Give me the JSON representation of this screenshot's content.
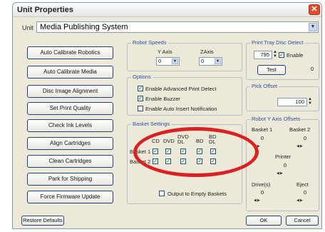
{
  "window": {
    "title": "Unit Properties",
    "close_icon": "close-icon"
  },
  "unit": {
    "label": "Unit",
    "value": "Media Publishing System"
  },
  "buttons": [
    "Auto Calibrate Robotics",
    "Auto Calibrate Media",
    "Disc Image Alignment",
    "Set Print Quality",
    "Check Ink Levels",
    "Align Cartridges",
    "Clean Cartridges",
    "Park for Shipping",
    "Force Firmware Update"
  ],
  "robot_speeds": {
    "legend": "Robot Speeds",
    "y_label": "Y Axis",
    "y_value": "0",
    "z_label": "ZAxis",
    "z_value": "0"
  },
  "options": {
    "legend": "Options",
    "items": [
      {
        "label": "Enable Advanced Print Detect",
        "checked": true
      },
      {
        "label": "Enable Buzzer",
        "checked": true
      },
      {
        "label": "Enable Auto Insert Notification",
        "checked": false
      }
    ]
  },
  "basket": {
    "legend": "Basket Settings",
    "columns": [
      "CD",
      "DVD",
      "DVD DL",
      "BD",
      "BD DL"
    ],
    "rows": [
      {
        "label": "Basket 1",
        "checks": [
          true,
          true,
          true,
          true,
          true
        ]
      },
      {
        "label": "Basket 2",
        "checks": [
          true,
          true,
          true,
          true,
          true
        ]
      }
    ],
    "output_label": "Output to Empty Baskets",
    "output_checked": false
  },
  "print_tray": {
    "legend": "Print Tray Disc Detect",
    "value": "795",
    "enable_label": "Enable",
    "enable_checked": true,
    "test_label": "Test",
    "test_value": "0"
  },
  "pick_offset": {
    "legend": "Pick Offset",
    "value": "100"
  },
  "robot_y": {
    "legend": "Robot Y Axis Offsets",
    "basket1_label": "Basket 1",
    "basket1_value": "0",
    "basket2_label": "Basket 2",
    "basket2_value": "0",
    "printer_label": "Printer",
    "printer_value": "0",
    "drives_label": "Drive(s)",
    "drives_value": "0",
    "eject_label": "Eject",
    "eject_value": "0"
  },
  "footer": {
    "restore": "Restore Defaults",
    "ok": "OK",
    "cancel": "Cancel"
  }
}
